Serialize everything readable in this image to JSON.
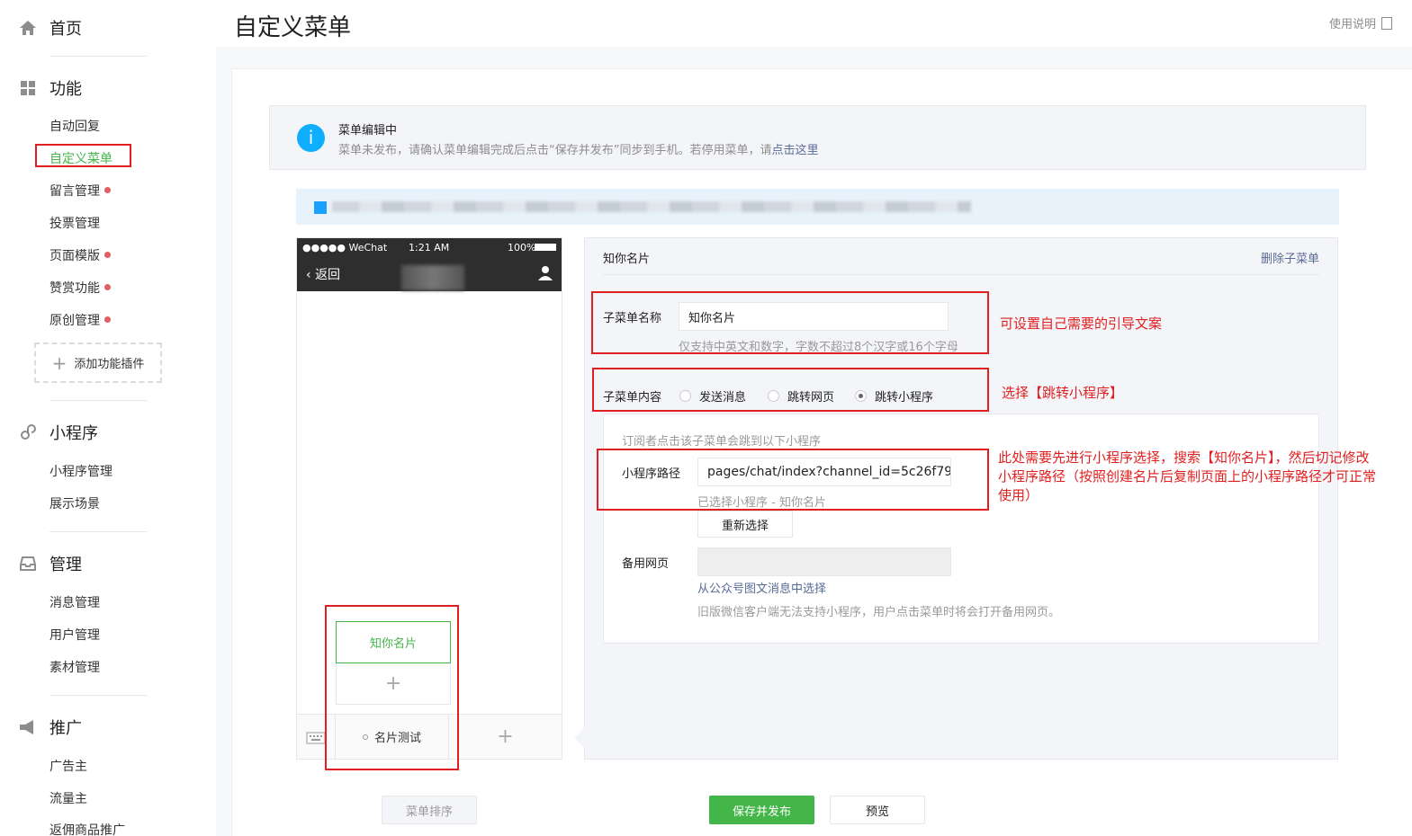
{
  "sidebar": {
    "home": "首页",
    "function_head": "功能",
    "function_items": [
      {
        "label": "自动回复",
        "dot": false
      },
      {
        "label": "自定义菜单",
        "dot": false,
        "active": true
      },
      {
        "label": "留言管理",
        "dot": true
      },
      {
        "label": "投票管理",
        "dot": false
      },
      {
        "label": "页面模版",
        "dot": true
      },
      {
        "label": "赞赏功能",
        "dot": true
      },
      {
        "label": "原创管理",
        "dot": true
      }
    ],
    "add_plugin": "添加功能插件",
    "miniprogram_head": "小程序",
    "miniprogram_items": [
      "小程序管理",
      "展示场景"
    ],
    "manage_head": "管理",
    "manage_items": [
      "消息管理",
      "用户管理",
      "素材管理"
    ],
    "promo_head": "推广",
    "promo_items": [
      "广告主",
      "流量主",
      "返佣商品推广"
    ]
  },
  "page": {
    "title": "自定义菜单",
    "help": "使用说明"
  },
  "notice": {
    "title": "菜单编辑中",
    "text": "菜单未发布，请确认菜单编辑完成后点击“保存并发布”同步到手机。若停用菜单，请",
    "link": "点击这里"
  },
  "phone": {
    "carrier": "●●●●● WeChat",
    "time": "1:21 AM",
    "battery": "100%",
    "back": "返回",
    "submenu_selected": "知你名片",
    "submenu_add": "+",
    "main_menu": "名片测试",
    "main_add": "+"
  },
  "editor": {
    "header": "知你名片",
    "delete": "删除子菜单",
    "name_label": "子菜单名称",
    "name_value": "知你名片",
    "name_hint": "仅支持中英文和数字，字数不超过8个汉字或16个字母",
    "content_label": "子菜单内容",
    "options": [
      "发送消息",
      "跳转网页",
      "跳转小程序"
    ],
    "selected_option": 2,
    "mp_hint": "订阅者点击该子菜单会跳到以下小程序",
    "path_label": "小程序路径",
    "path_value": "pages/chat/index?channel_id=5c26f79",
    "selected_mp": "已选择小程序 - 知你名片",
    "reselect": "重新选择",
    "backup_label": "备用网页",
    "backup_value": "",
    "backup_link": "从公众号图文消息中选择",
    "backup_hint": "旧版微信客户端无法支持小程序，用户点击菜单时将会打开备用网页。"
  },
  "annotations": {
    "a1": "可设置自己需要的引导文案",
    "a2": "选择【跳转小程序】",
    "a3_l1": "此处需要先进行小程序选择，搜索【知你名片】，然后切记修改",
    "a3_l2": "小程序路径（按照创建名片后复制页面上的小程序路径才可正常",
    "a3_l3": "使用）"
  },
  "buttons": {
    "sort": "菜单排序",
    "save": "保存并发布",
    "preview": "预览"
  },
  "colors": {
    "accent_green": "#44b549",
    "annotation_red": "#e02020",
    "link_blue": "#576b95",
    "info_blue": "#10aeff"
  }
}
